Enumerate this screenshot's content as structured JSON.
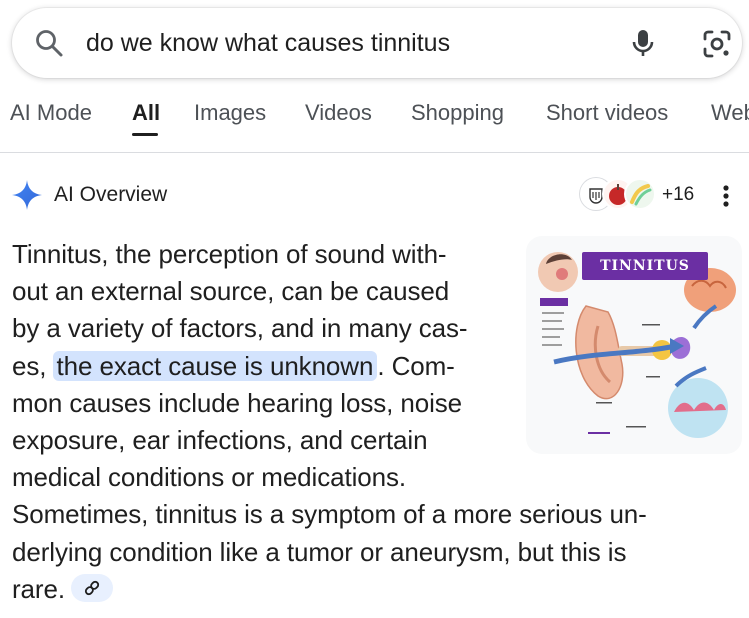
{
  "search": {
    "query": "do we know what causes tinnitus"
  },
  "tabs": [
    {
      "label": "AI Mode",
      "active": false
    },
    {
      "label": "All",
      "active": true
    },
    {
      "label": "Images",
      "active": false
    },
    {
      "label": "Videos",
      "active": false
    },
    {
      "label": "Shopping",
      "active": false
    },
    {
      "label": "Short videos",
      "active": false
    },
    {
      "label": "Web",
      "active": false
    }
  ],
  "ai_overview": {
    "title": "AI Overview",
    "sources_more": "+16",
    "thumbnail_title": "TINNITUS",
    "lines": [
      "Tinnitus, the perception of sound with-",
      "out an external source, can be caused",
      "by a variety of factors, and in many cas-"
    ],
    "line4_prefix": "es, ",
    "line4_highlight": "the exact cause is unknown",
    "line4_suffix": ". Com-",
    "lines_after": [
      "mon causes include hearing loss, noise",
      "exposure, ear infections, and certain",
      "medical conditions or medications."
    ],
    "full_lines": [
      "Sometimes, tinnitus is a symptom of a more serious un-",
      "derlying condition like a tumor or aneurysm, but this is"
    ],
    "last_line": "rare."
  },
  "icons": {
    "search": "search-icon",
    "mic": "microphone-icon",
    "lens": "google-lens-icon",
    "sparkle": "gemini-sparkle-icon",
    "menu": "more-vert-icon",
    "link": "link-icon"
  },
  "colors": {
    "highlight": "#d3e3fd",
    "sparkle": "#4285f4",
    "thumbnail_banner": "#6b2fa3"
  }
}
